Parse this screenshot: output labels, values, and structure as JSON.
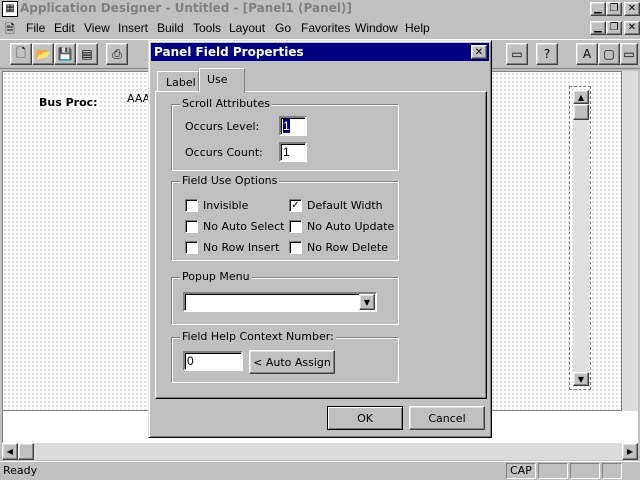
{
  "app": {
    "title": "Application Designer - Untitled - [Panel1 (Panel)]"
  },
  "menu": [
    "File",
    "Edit",
    "View",
    "Insert",
    "Build",
    "Tools",
    "Layout",
    "Go",
    "Favorites",
    "Window",
    "Help"
  ],
  "panel": {
    "field_label": "Bus Proc:",
    "field_value": "AAA"
  },
  "dialog": {
    "title": "Panel Field Properties",
    "tabs": [
      "Label",
      "Use"
    ],
    "active_tab": "Use",
    "scroll_attributes": {
      "group_label": "Scroll Attributes",
      "occurs_level_label": "Occurs Level:",
      "occurs_level_value": "1",
      "occurs_count_label": "Occurs Count:",
      "occurs_count_value": "1"
    },
    "field_use_options": {
      "group_label": "Field Use Options",
      "options": [
        {
          "label": "Invisible",
          "checked": false
        },
        {
          "label": "Default Width",
          "checked": true
        },
        {
          "label": "No Auto Select",
          "checked": false
        },
        {
          "label": "No Auto Update",
          "checked": false
        },
        {
          "label": "No Row Insert",
          "checked": false
        },
        {
          "label": "No Row Delete",
          "checked": false
        }
      ]
    },
    "popup_menu": {
      "group_label": "Popup Menu",
      "selected": ""
    },
    "help_context": {
      "group_label": "Field Help Context Number:",
      "value": "0",
      "auto_assign_label": "< Auto Assign"
    },
    "ok_label": "OK",
    "cancel_label": "Cancel"
  },
  "status": {
    "text": "Ready",
    "cap": "CAP"
  },
  "colors": {
    "face": "#c0c0c0",
    "title_active": "#000080",
    "title_inactive_text": "#808080"
  }
}
